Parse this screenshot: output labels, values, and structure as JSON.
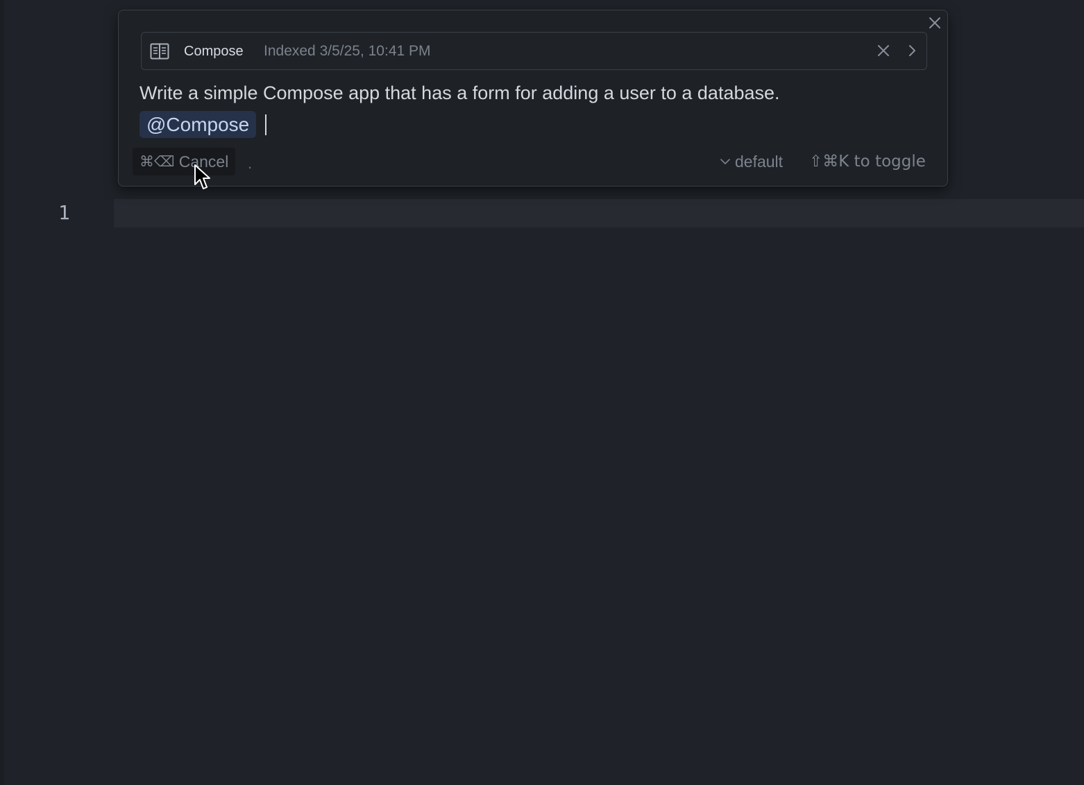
{
  "editor": {
    "line_numbers": [
      "1"
    ]
  },
  "context_chip": {
    "icon": "book-icon",
    "name": "Compose",
    "meta": "Indexed 3/5/25, 10:41 PM"
  },
  "prompt": {
    "text": "Write a simple Compose app that has a form for adding a user to a database.",
    "mention": "@Compose"
  },
  "footer": {
    "cancel_shortcut": "⌘⌫",
    "cancel_label": "Cancel",
    "separator": ".",
    "model_label": "default",
    "toggle_hint": "⇧⌘K to toggle"
  },
  "colors": {
    "background": "#1f2329",
    "popup_background": "#1e2126",
    "mention_background": "#26324a"
  }
}
